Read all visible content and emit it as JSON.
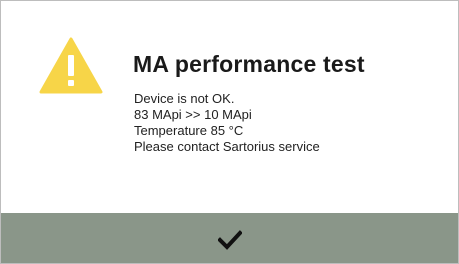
{
  "dialog": {
    "icon": "warning-triangle-icon",
    "title": "MA performance test",
    "message_lines": [
      "Device is not OK.",
      "83 MApi >> 10 MApi",
      "Temperature 85 °C",
      "Please contact Sartorius service"
    ],
    "confirm_icon": "checkmark-icon"
  },
  "colors": {
    "warning_yellow": "#f7d548",
    "footer_bg": "#8a9689",
    "text": "#1a1a1a"
  }
}
